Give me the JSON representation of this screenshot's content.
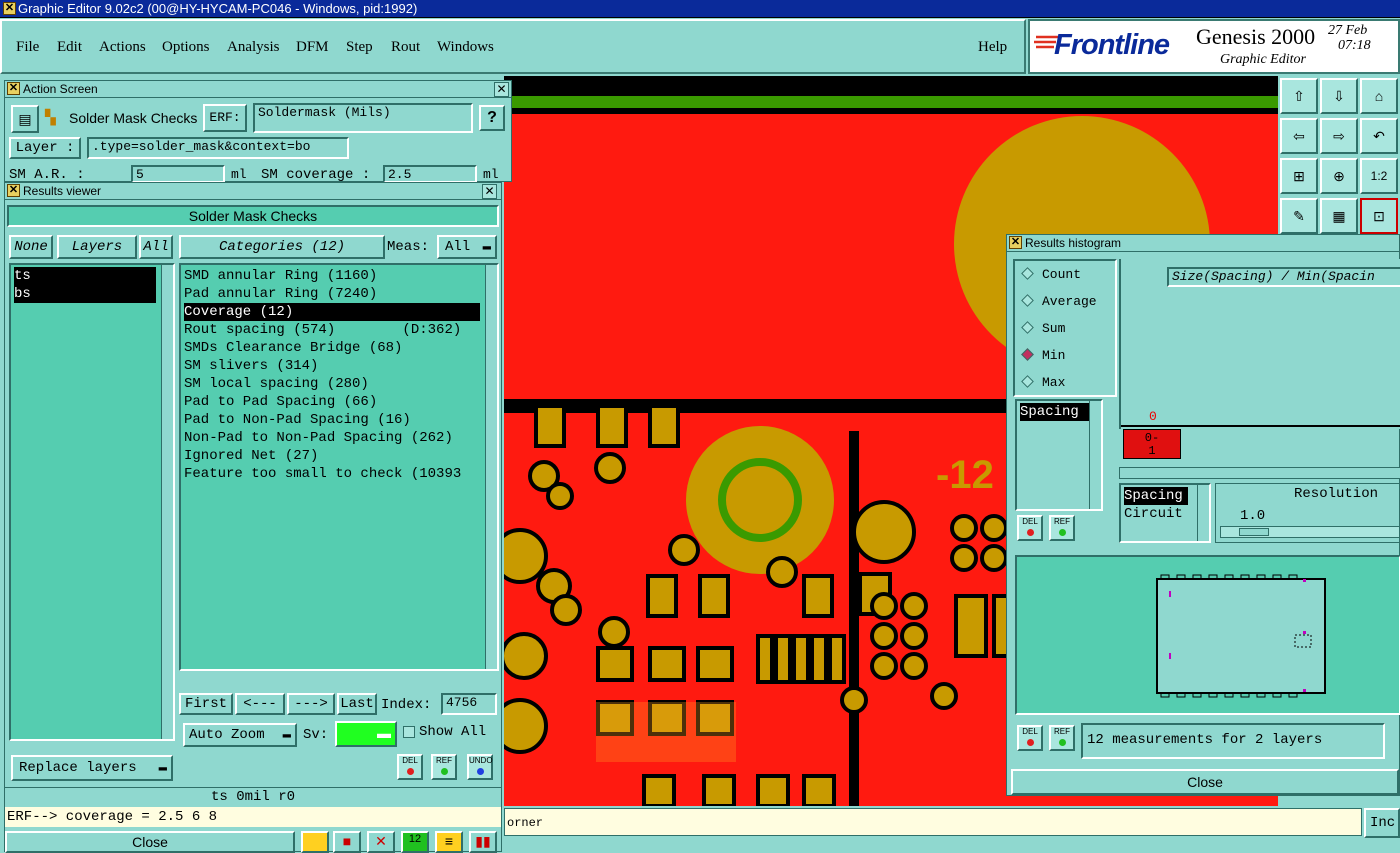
{
  "window_title": "Graphic Editor 9.02c2 (00@HY-HYCAM-PC046 - Windows, pid:1992)",
  "menu": [
    "File",
    "Edit",
    "Actions",
    "Options",
    "Analysis",
    "DFM",
    "Step",
    "Rout",
    "Windows"
  ],
  "help": "Help",
  "brand": {
    "logo": "Frontline",
    "product": "Genesis 2000",
    "subtitle": "Graphic Editor",
    "date": "27 Feb",
    "time": "07:18"
  },
  "action_screen": {
    "title": "Action Screen",
    "name": "Solder Mask Checks",
    "erf_label": "ERF:",
    "erf_value": "Soldermask (Mils)",
    "help": "?",
    "layer_label": "Layer :",
    "layer_value": ".type=solder_mask&context=bo",
    "sm_ar_label": "SM A.R.   :",
    "sm_ar_value": "5",
    "unit1": "ml",
    "sm_cov_label": "SM coverage :",
    "sm_cov_value": "2.5",
    "unit2": "ml"
  },
  "results_viewer": {
    "title": "Results viewer",
    "header": "Solder Mask Checks",
    "none": "None",
    "layers_btn": "Layers",
    "all": "All",
    "layers": [
      "ts",
      "bs"
    ],
    "categories_btn": "Categories (12)",
    "meas_label": "Meas:",
    "meas_value": "All",
    "categories": [
      "SMD annular Ring (1160)",
      "Pad annular Ring (7240)",
      "Coverage (12)",
      "Rout spacing (574)        (D:362)",
      "SMDs Clearance Bridge (68)",
      "SM slivers (314)",
      "SM local spacing (280)",
      "Pad to Pad Spacing (66)",
      "Pad to Non-Pad Spacing (16)",
      "Non-Pad to Non-Pad Spacing (262)",
      "Ignored Net (27)",
      "Feature too small to check (10393"
    ],
    "selected_category": 2,
    "first": "First",
    "prev": "<---",
    "next": "--->",
    "last": "Last",
    "index_label": "Index:",
    "index_value": "4756",
    "auto_zoom": "Auto Zoom",
    "sv_label": "Sv:",
    "show_all": "Show All",
    "replace_layers": "Replace layers",
    "del": "DEL",
    "ref": "REF",
    "undo": "UNDO",
    "status": "ts 0mil  r0",
    "erf_line": "ERF--> coverage = 2.5 6 8",
    "close": "Close"
  },
  "histogram": {
    "title": "Results histogram",
    "options": [
      "Count",
      "Average",
      "Sum",
      "Min",
      "Max"
    ],
    "selected_option": 3,
    "plot_title": "Size(Spacing) / Min(Spacin",
    "bar_top": "0",
    "bar_label": "0-\n1",
    "list1": [
      "Spacing"
    ],
    "list2": [
      "Spacing",
      "Circuit"
    ],
    "resolution_label": "Resolution",
    "resolution_value": "1.0",
    "summary": "12 measurements for 2 layers",
    "close": "Close"
  },
  "bottom": {
    "status": "orner",
    "inc": "Inc"
  },
  "colors": {
    "teal": "#8fd8cf",
    "green": "#55cdb0",
    "red": "#ff1a10",
    "copper": "#c89a00"
  }
}
